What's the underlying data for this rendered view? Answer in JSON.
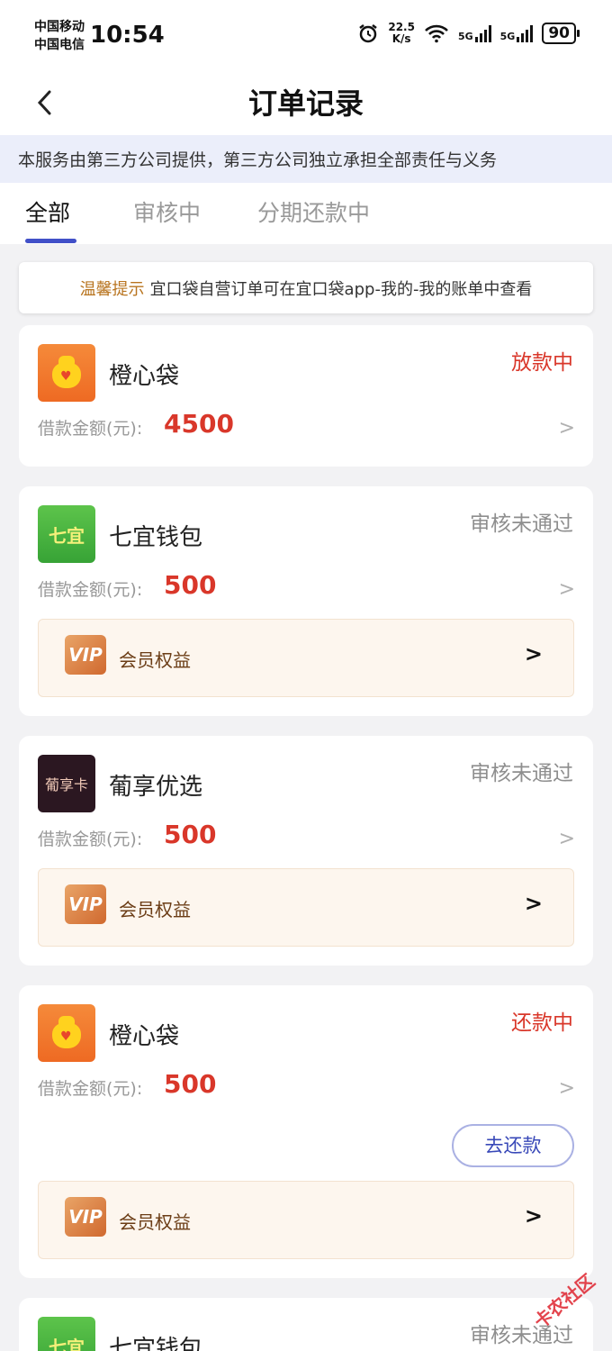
{
  "status_bar": {
    "carrier_1": "中国移动",
    "carrier_2": "中国电信",
    "time": "10:54",
    "net_speed_value": "22.5",
    "net_speed_unit": "K/s",
    "signal_1": "5G",
    "signal_2": "5G",
    "battery": "90"
  },
  "header": {
    "title": "订单记录",
    "back_icon": "chevron-left-icon"
  },
  "notice": "本服务由第三方公司提供，第三方公司独立承担全部责任与义务",
  "tabs": [
    {
      "label": "全部",
      "active": true
    },
    {
      "label": "审核中",
      "active": false
    },
    {
      "label": "分期还款中",
      "active": false
    }
  ],
  "tip": {
    "label": "温馨提示",
    "text": "宜口袋自营订单可在宜口袋app-我的-我的账单中查看"
  },
  "amount_label": "借款金额(元):",
  "vip_label": "会员权益",
  "vip_icon_text": "VIP",
  "orders": [
    {
      "name": "橙心袋",
      "status": "放款中",
      "amount": "4500",
      "logo": "orange-bag-icon"
    },
    {
      "name": "七宜钱包",
      "status": "审核未通过",
      "amount": "500",
      "logo_text": "七宜"
    },
    {
      "name": "葡享优选",
      "status": "审核未通过",
      "amount": "500",
      "logo_text": "葡享卡"
    },
    {
      "name": "橙心袋",
      "status": "还款中",
      "amount": "500",
      "logo": "orange-bag-icon",
      "action": "去还款"
    },
    {
      "name": "七宜钱包",
      "status": "审核未通过",
      "logo_text": "七宜"
    }
  ],
  "watermark": "卡农社区",
  "colors": {
    "accent": "#4150c8",
    "status_red": "#d9372a",
    "status_gray": "#8e8e8e",
    "tip_label": "#b8741f"
  }
}
